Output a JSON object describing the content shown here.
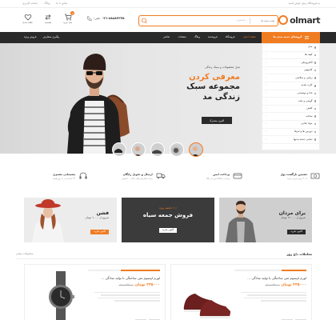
{
  "topbar": {
    "welcome": "به فروشگاه زنبیل خوش آمدید",
    "links": [
      "تماس با ما",
      "وبلاگ",
      "حساب کاربری"
    ]
  },
  "header": {
    "logo_text": "olmart",
    "search_placeholder": "جستجو...",
    "search_category": "همه دسته ها",
    "phone_label": "تلفن:",
    "phone_number": "۰۲۱-۸۸۸۸۲۲۲۵",
    "icons": [
      {
        "label": "علاقه مندی",
        "icon": "heart-icon"
      },
      {
        "label": "مقایسه",
        "icon": "compare-icon"
      },
      {
        "label": "سبد خرید",
        "icon": "cart-icon",
        "badge": "0"
      }
    ]
  },
  "nav": {
    "categories_label": "گروه‌های دسته بندی ها",
    "items": [
      "صفحه اصلی",
      "فروشگاه",
      "فروشنده",
      "وبلاگ",
      "صفحات",
      "عناصر"
    ],
    "left_items": [
      "پیگیری سفارش",
      "فروش ویژه"
    ]
  },
  "categories": [
    "مدل",
    "کیف ها",
    "الکترونیکی",
    "کامپیوتر",
    "زیبایی و سلامتی",
    "کارت هدیه",
    "غذا و نوشیدنی",
    "گوشی و تبلت",
    "کفش",
    "ساعت",
    "مواد غذایی",
    "دوربین ها و لنزها",
    "تمامی دسته بندیها"
  ],
  "hero": {
    "small": "مدل محصولات و سبک زندگی",
    "orange": "معرفی کردن",
    "black": "مجموعه سبک زندگی مد",
    "button": "اکنون مشترک"
  },
  "features": [
    {
      "title": "تضمین بازگشت پول",
      "sub": "تا ۳۰ روز پس از خرید",
      "icon": "money-icon"
    },
    {
      "title": "پرداخت ایمن",
      "sub": "پرداخت کاملاً امن با درگاه",
      "icon": "card-icon"
    },
    {
      "title": "ارسال و تحویل رایگان",
      "sub": "برای سفارش های بالای ۵۰۰ هزار",
      "icon": "truck-icon"
    },
    {
      "title": "پشتیبانی مشتری",
      "sub": "۲۴ ساعته در ۷ روز هفته",
      "icon": "headset-icon"
    }
  ],
  "banners": {
    "men": {
      "title": "برای مردان",
      "sub": "شروع از ۱۲۰۰۰۰ تومان",
      "button": "اکنون بخرید"
    },
    "black_friday": {
      "tag": "۲۰٪ تخفیف ویژه",
      "title": "فروش جمعه سیاه",
      "button": "اکنون بخرید"
    },
    "women": {
      "title": "فشن",
      "sub": "شروع از ۹۰۰۰۰ تومان",
      "button": "اکنون بخرید"
    }
  },
  "deals": {
    "title": "معاملات داغ روز",
    "more": "محصولات بیشتر",
    "items": [
      {
        "title": "لورم ایپسوم متن ساختگی با تولید سادگی ...",
        "price": "۲۳۵۰۰۰ تومان",
        "old_price": "۴۵۰۰۰ تومان",
        "sold_pct": 0.35
      },
      {
        "title": "لورم ایپسوم متن ساختگی با تولید سادگی ...",
        "price": "۲۳۵۰۰۰ تومان",
        "old_price": "۴۵۰۰۰ تومان",
        "sold_pct": 0.55
      }
    ]
  },
  "colors": {
    "accent": "#f07c22",
    "dark": "#2a2a2a"
  }
}
